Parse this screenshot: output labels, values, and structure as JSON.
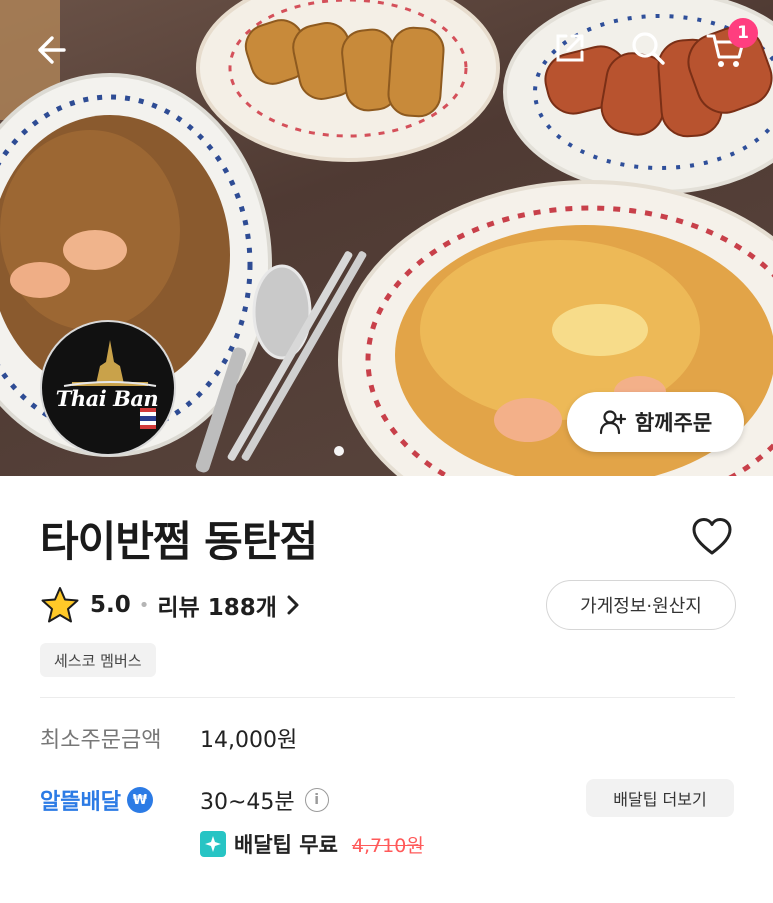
{
  "hero": {
    "logo_text": "Thai Ban",
    "group_order_label": "함께주문",
    "cart_count": "1",
    "photo_description_icons": [
      "back-arrow-icon",
      "share-icon",
      "search-icon",
      "cart-icon"
    ]
  },
  "store": {
    "name": "타이반쩜 동탄점",
    "rating": "5.0",
    "review_label": "리뷰 188개",
    "info_button": "가게정보·원산지",
    "tag": "세스코 멤버스"
  },
  "order": {
    "min_order_label": "최소주문금액",
    "min_order_value": "14,000원",
    "delivery_label": "알뜰배달",
    "delivery_badge": "₩",
    "delivery_time": "30~45분",
    "info_symbol": "i",
    "tip_more_button": "배달팁 더보기",
    "free_tip_label": "배달팁 무료",
    "old_tip": "4,710원"
  },
  "colors": {
    "accent_blue": "#2c7be5",
    "badge_pink": "#ff3e7f",
    "strike_red": "#ff5a5a",
    "tip_teal": "#27c4c4"
  }
}
